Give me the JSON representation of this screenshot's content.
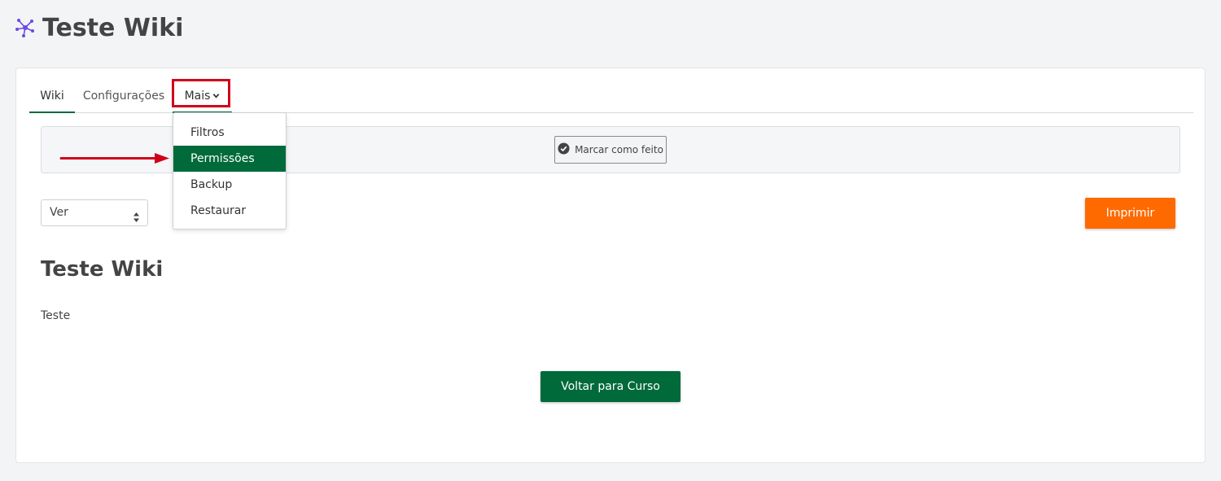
{
  "header": {
    "title": "Teste Wiki",
    "icon": "wiki-network-icon",
    "icon_color": "#6c4ae0"
  },
  "tabs": [
    {
      "label": "Wiki",
      "active": true
    },
    {
      "label": "Configurações",
      "active": false
    },
    {
      "label": "Mais",
      "active": false
    }
  ],
  "dropdown": {
    "items": [
      {
        "label": "Filtros"
      },
      {
        "label": "Permissões",
        "selected": true
      },
      {
        "label": "Backup"
      },
      {
        "label": "Restaurar"
      }
    ]
  },
  "activity": {
    "done_label": "Marcar como feito"
  },
  "view_select": {
    "value": "Ver"
  },
  "print_button": {
    "label": "Imprimir",
    "color": "#ff6a00"
  },
  "content": {
    "title": "Teste Wiki",
    "text": "Teste"
  },
  "back_button": {
    "label": "Voltar para Curso",
    "color": "#006a3a"
  },
  "annotation": {
    "color": "#d0021b"
  }
}
